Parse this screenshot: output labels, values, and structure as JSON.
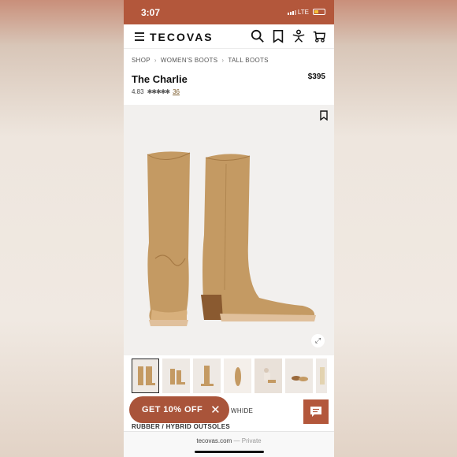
{
  "status": {
    "time": "3:07",
    "network": "LTE"
  },
  "nav": {
    "logo": "TECOVAS"
  },
  "breadcrumb": [
    "SHOP",
    "WOMEN'S BOOTS",
    "TALL BOOTS"
  ],
  "product": {
    "title": "The Charlie",
    "price": "$395",
    "rating": "4.83",
    "stars": "✱✱✱✱✱",
    "review_count": "36"
  },
  "promo": {
    "label": "GET 10% OFF",
    "close": "✕"
  },
  "details": {
    "width": "WHIDE",
    "outsoles": "RUBBER / HYBRID OUTSOLES"
  },
  "browser": {
    "domain": "tecovas.com",
    "separator": "—",
    "mode": "Private"
  },
  "colors": {
    "brand": "#b3573b",
    "promo": "#a9543a",
    "boot": "#c49a63"
  }
}
